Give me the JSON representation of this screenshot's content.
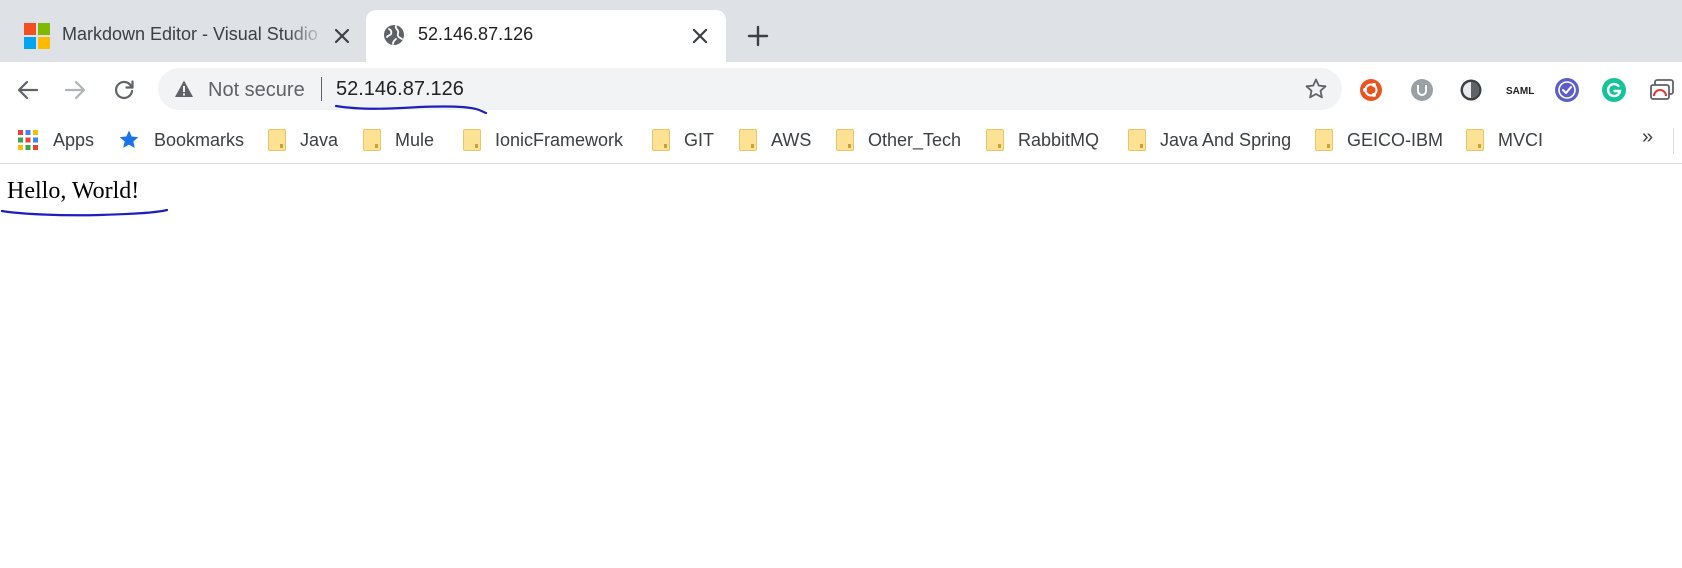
{
  "tabs": [
    {
      "title": "Markdown Editor - Visual Studio",
      "favicon": "microsoft-logo-icon",
      "active": false
    },
    {
      "title": "52.146.87.126",
      "favicon": "globe-icon",
      "active": true
    }
  ],
  "toolbar": {
    "security_label": "Not secure",
    "url": "52.146.87.126"
  },
  "extensions": [
    "ubuntu-icon",
    "ublock-icon",
    "dark-mode-icon",
    "saml-tracer-icon",
    "tasks-check-icon",
    "grammarly-icon",
    "window-icon"
  ],
  "extension_labels": {
    "saml": "SAML"
  },
  "bookmarks": {
    "apps_label": "Apps",
    "items": [
      {
        "label": "Bookmarks",
        "icon": "star-icon"
      },
      {
        "label": "Java",
        "icon": "folder-icon"
      },
      {
        "label": "Mule",
        "icon": "folder-icon"
      },
      {
        "label": "IonicFramework",
        "icon": "folder-icon"
      },
      {
        "label": "GIT",
        "icon": "folder-icon"
      },
      {
        "label": "AWS",
        "icon": "folder-icon"
      },
      {
        "label": "Other_Tech",
        "icon": "folder-icon"
      },
      {
        "label": "RabbitMQ",
        "icon": "folder-icon"
      },
      {
        "label": "Java And Spring",
        "icon": "folder-icon"
      },
      {
        "label": "GEICO-IBM",
        "icon": "folder-icon"
      },
      {
        "label": "MVCI",
        "icon": "folder-icon"
      }
    ],
    "overflow_label": "»"
  },
  "page": {
    "body_text": "Hello, World!"
  },
  "colors": {
    "tabstrip": "#dee1e6",
    "omnibox": "#f1f3f4",
    "folder": "#fde293",
    "annotation_ink": "#1f1fbf"
  }
}
